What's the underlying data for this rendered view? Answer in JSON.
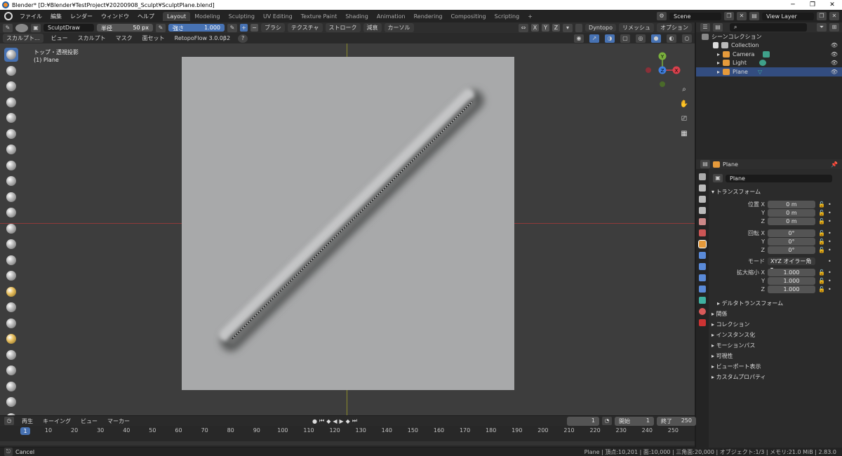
{
  "window": {
    "title": "Blender* [D:¥Blender¥TestProject¥20200908_Sculpt¥SculptPlane.blend]",
    "controls": [
      "─",
      "❐",
      "✕"
    ]
  },
  "menubar": {
    "items": [
      "ファイル",
      "編集",
      "レンダー",
      "ウィンドウ",
      "ヘルプ"
    ],
    "tabs": [
      "Layout",
      "Modeling",
      "Sculpting",
      "UV Editing",
      "Texture Paint",
      "Shading",
      "Animation",
      "Rendering",
      "Compositing",
      "Scripting"
    ],
    "add_tab": "+",
    "scene": "Scene",
    "view_layer": "View Layer"
  },
  "tool_header": {
    "brush_name": "SculptDraw",
    "radius_label": "半径",
    "radius_value": "50 px",
    "strength_label": "強さ",
    "strength_value": "1.000",
    "strength_fraction": 1.0,
    "plus": "+",
    "minus": "−",
    "brush_menu": "ブラシ",
    "texture_menu": "テクスチャ",
    "stroke_menu": "ストローク",
    "falloff_menu": "減衰",
    "cursor_menu": "カーソル",
    "x": "X",
    "y": "Y",
    "z": "Z",
    "dyntopo": "Dyntopo",
    "remesh": "リメッシュ",
    "options": "オプション"
  },
  "view_header": {
    "mode": "スカルプト...",
    "items": [
      "ビュー",
      "スカルプト",
      "マスク",
      "面セット"
    ],
    "addon": "RetopoFlow 3.0.0β2",
    "help": "?"
  },
  "viewport": {
    "view_name": "トップ・透視投影",
    "object_name": "(1) Plane",
    "gizmo": {
      "y": "Y",
      "z": "Z",
      "x": "X"
    }
  },
  "timeline": {
    "menus": [
      "再生",
      "キーイング",
      "ビュー",
      "マーカー"
    ],
    "current_frame": "1",
    "start_label": "開始",
    "start": "1",
    "end_label": "終了",
    "end": "250",
    "ticks": [
      "1",
      "10",
      "20",
      "30",
      "40",
      "50",
      "60",
      "70",
      "80",
      "90",
      "100",
      "110",
      "120",
      "130",
      "140",
      "150",
      "160",
      "170",
      "180",
      "190",
      "200",
      "210",
      "220",
      "230",
      "240",
      "250"
    ]
  },
  "statusbar": {
    "left": "Cancel",
    "right": "Plane | 頂点:10,201 | 面:10,000 | 三角面:20,000 | オブジェクト:1/3 | メモリ:21.0 MiB | 2.83.0"
  },
  "outliner": {
    "root": "シーンコレクション",
    "collection": "Collection",
    "items": [
      "Camera",
      "Light",
      "Plane"
    ]
  },
  "properties": {
    "header_object": "Plane",
    "object_name": "Plane",
    "transform_title": "トランスフォーム",
    "location_label": "位置 X",
    "rotation_label": "回転 X",
    "scale_label": "拡大縮小 X",
    "y": "Y",
    "z": "Z",
    "loc": [
      "0 m",
      "0 m",
      "0 m"
    ],
    "rot": [
      "0°",
      "0°",
      "0°"
    ],
    "mode_label": "モード",
    "mode_value": "XYZ オイラー角",
    "scale": [
      "1.000",
      "1.000",
      "1.000"
    ],
    "delta": "デルタトランスフォーム",
    "sections": [
      "関係",
      "コレクション",
      "インスタンス化",
      "モーションパス",
      "可視性",
      "ビューポート表示",
      "カスタムプロパティ"
    ]
  },
  "colors": {
    "accent": "#4772b3",
    "selected": "#334d80",
    "axis_x": "#d9404c",
    "axis_y": "#7ab03d",
    "axis_z": "#3f7fe0"
  }
}
